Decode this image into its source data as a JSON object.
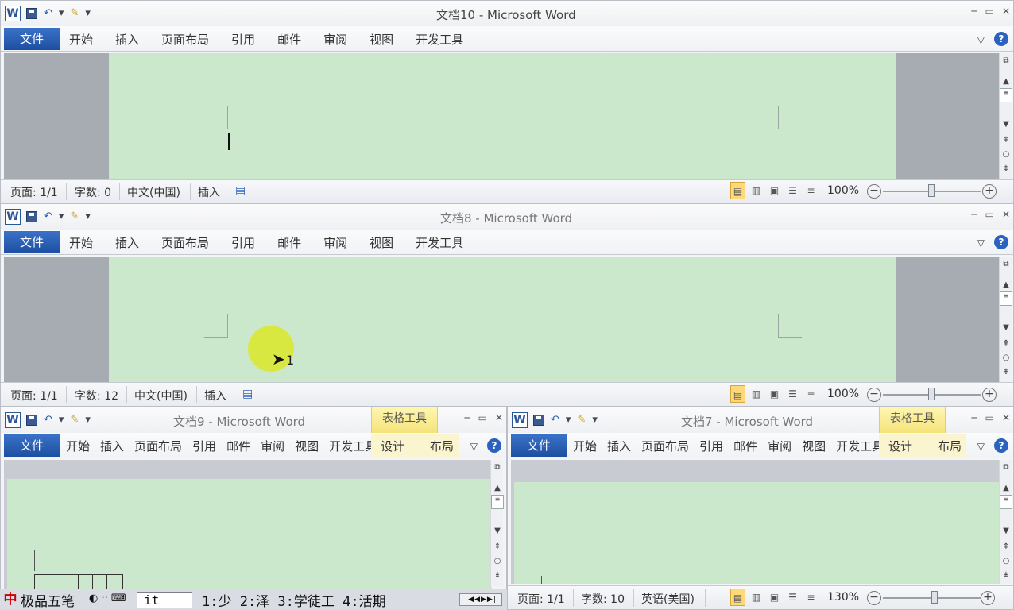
{
  "app": {
    "logo_letter": "W",
    "qat_sep": "▾",
    "minimize": "▭",
    "restore": "▭",
    "close": "✕",
    "ribbon_chevron": "▽",
    "help": "?"
  },
  "ribbon_tabs_full": [
    "文件",
    "开始",
    "插入",
    "页面布局",
    "引用",
    "邮件",
    "审阅",
    "视图",
    "开发工具"
  ],
  "windows": [
    {
      "title": "文档10 - Microsoft Word",
      "status": {
        "page": "页面: 1/1",
        "words": "字数: 0",
        "lang": "中文(中国)",
        "mode": "插入",
        "zoom": "100%"
      }
    },
    {
      "title": "文档8 - Microsoft Word",
      "status": {
        "page": "页面: 1/1",
        "words": "字数: 12",
        "lang": "中文(中国)",
        "mode": "插入",
        "zoom": "100%"
      },
      "cursor_label": "1"
    },
    {
      "title": "文档9 - Microsoft Word",
      "context_group": "表格工具",
      "context_tabs": [
        "设计",
        "布局"
      ]
    },
    {
      "title": "文档7 - Microsoft Word",
      "context_group": "表格工具",
      "context_tabs": [
        "设计",
        "布局"
      ],
      "status": {
        "page": "页面: 1/1",
        "words": "字数: 10",
        "lang": "英语(美国)",
        "zoom": "130%"
      }
    }
  ],
  "ime": {
    "name": "极品五笔",
    "input": "it",
    "candidates": "1:少 2:泽 3:学徒工 4:活期",
    "nav": "|◀◀▶▶|"
  }
}
